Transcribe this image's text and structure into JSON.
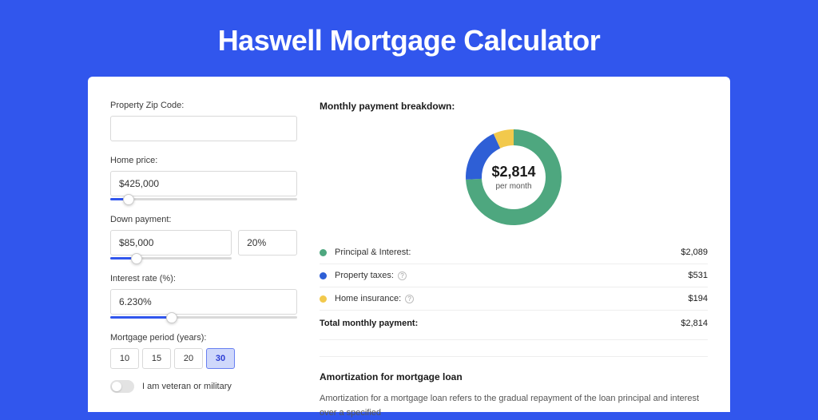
{
  "title": "Haswell Mortgage Calculator",
  "form": {
    "zip_label": "Property Zip Code:",
    "zip_value": "",
    "home_price_label": "Home price:",
    "home_price_value": "$425,000",
    "home_price_slider_pct": 10,
    "down_payment_label": "Down payment:",
    "down_payment_value": "$85,000",
    "down_payment_pct_value": "20%",
    "down_payment_slider_pct": 22,
    "interest_label": "Interest rate (%):",
    "interest_value": "6.230%",
    "interest_slider_pct": 33,
    "period_label": "Mortgage period (years):",
    "period_options": [
      "10",
      "15",
      "20",
      "30"
    ],
    "period_selected": "30",
    "veteran_label": "I am veteran or military",
    "veteran_on": false
  },
  "breakdown": {
    "title": "Monthly payment breakdown:",
    "center_amount": "$2,814",
    "center_label": "per month",
    "items": [
      {
        "label": "Principal & Interest:",
        "value": "$2,089",
        "color": "#4ea77f",
        "has_help": false
      },
      {
        "label": "Property taxes:",
        "value": "$531",
        "color": "#2e5fd6",
        "has_help": true
      },
      {
        "label": "Home insurance:",
        "value": "$194",
        "color": "#f2c94c",
        "has_help": true
      }
    ],
    "total_label": "Total monthly payment:",
    "total_value": "$2,814"
  },
  "amortization": {
    "title": "Amortization for mortgage loan",
    "body": "Amortization for a mortgage loan refers to the gradual repayment of the loan principal and interest over a specified"
  },
  "chart_data": {
    "type": "pie",
    "title": "Monthly payment breakdown",
    "series": [
      {
        "name": "Principal & Interest",
        "value": 2089,
        "color": "#4ea77f"
      },
      {
        "name": "Property taxes",
        "value": 531,
        "color": "#2e5fd6"
      },
      {
        "name": "Home insurance",
        "value": 194,
        "color": "#f2c94c"
      }
    ],
    "total": 2814,
    "unit": "USD per month"
  }
}
